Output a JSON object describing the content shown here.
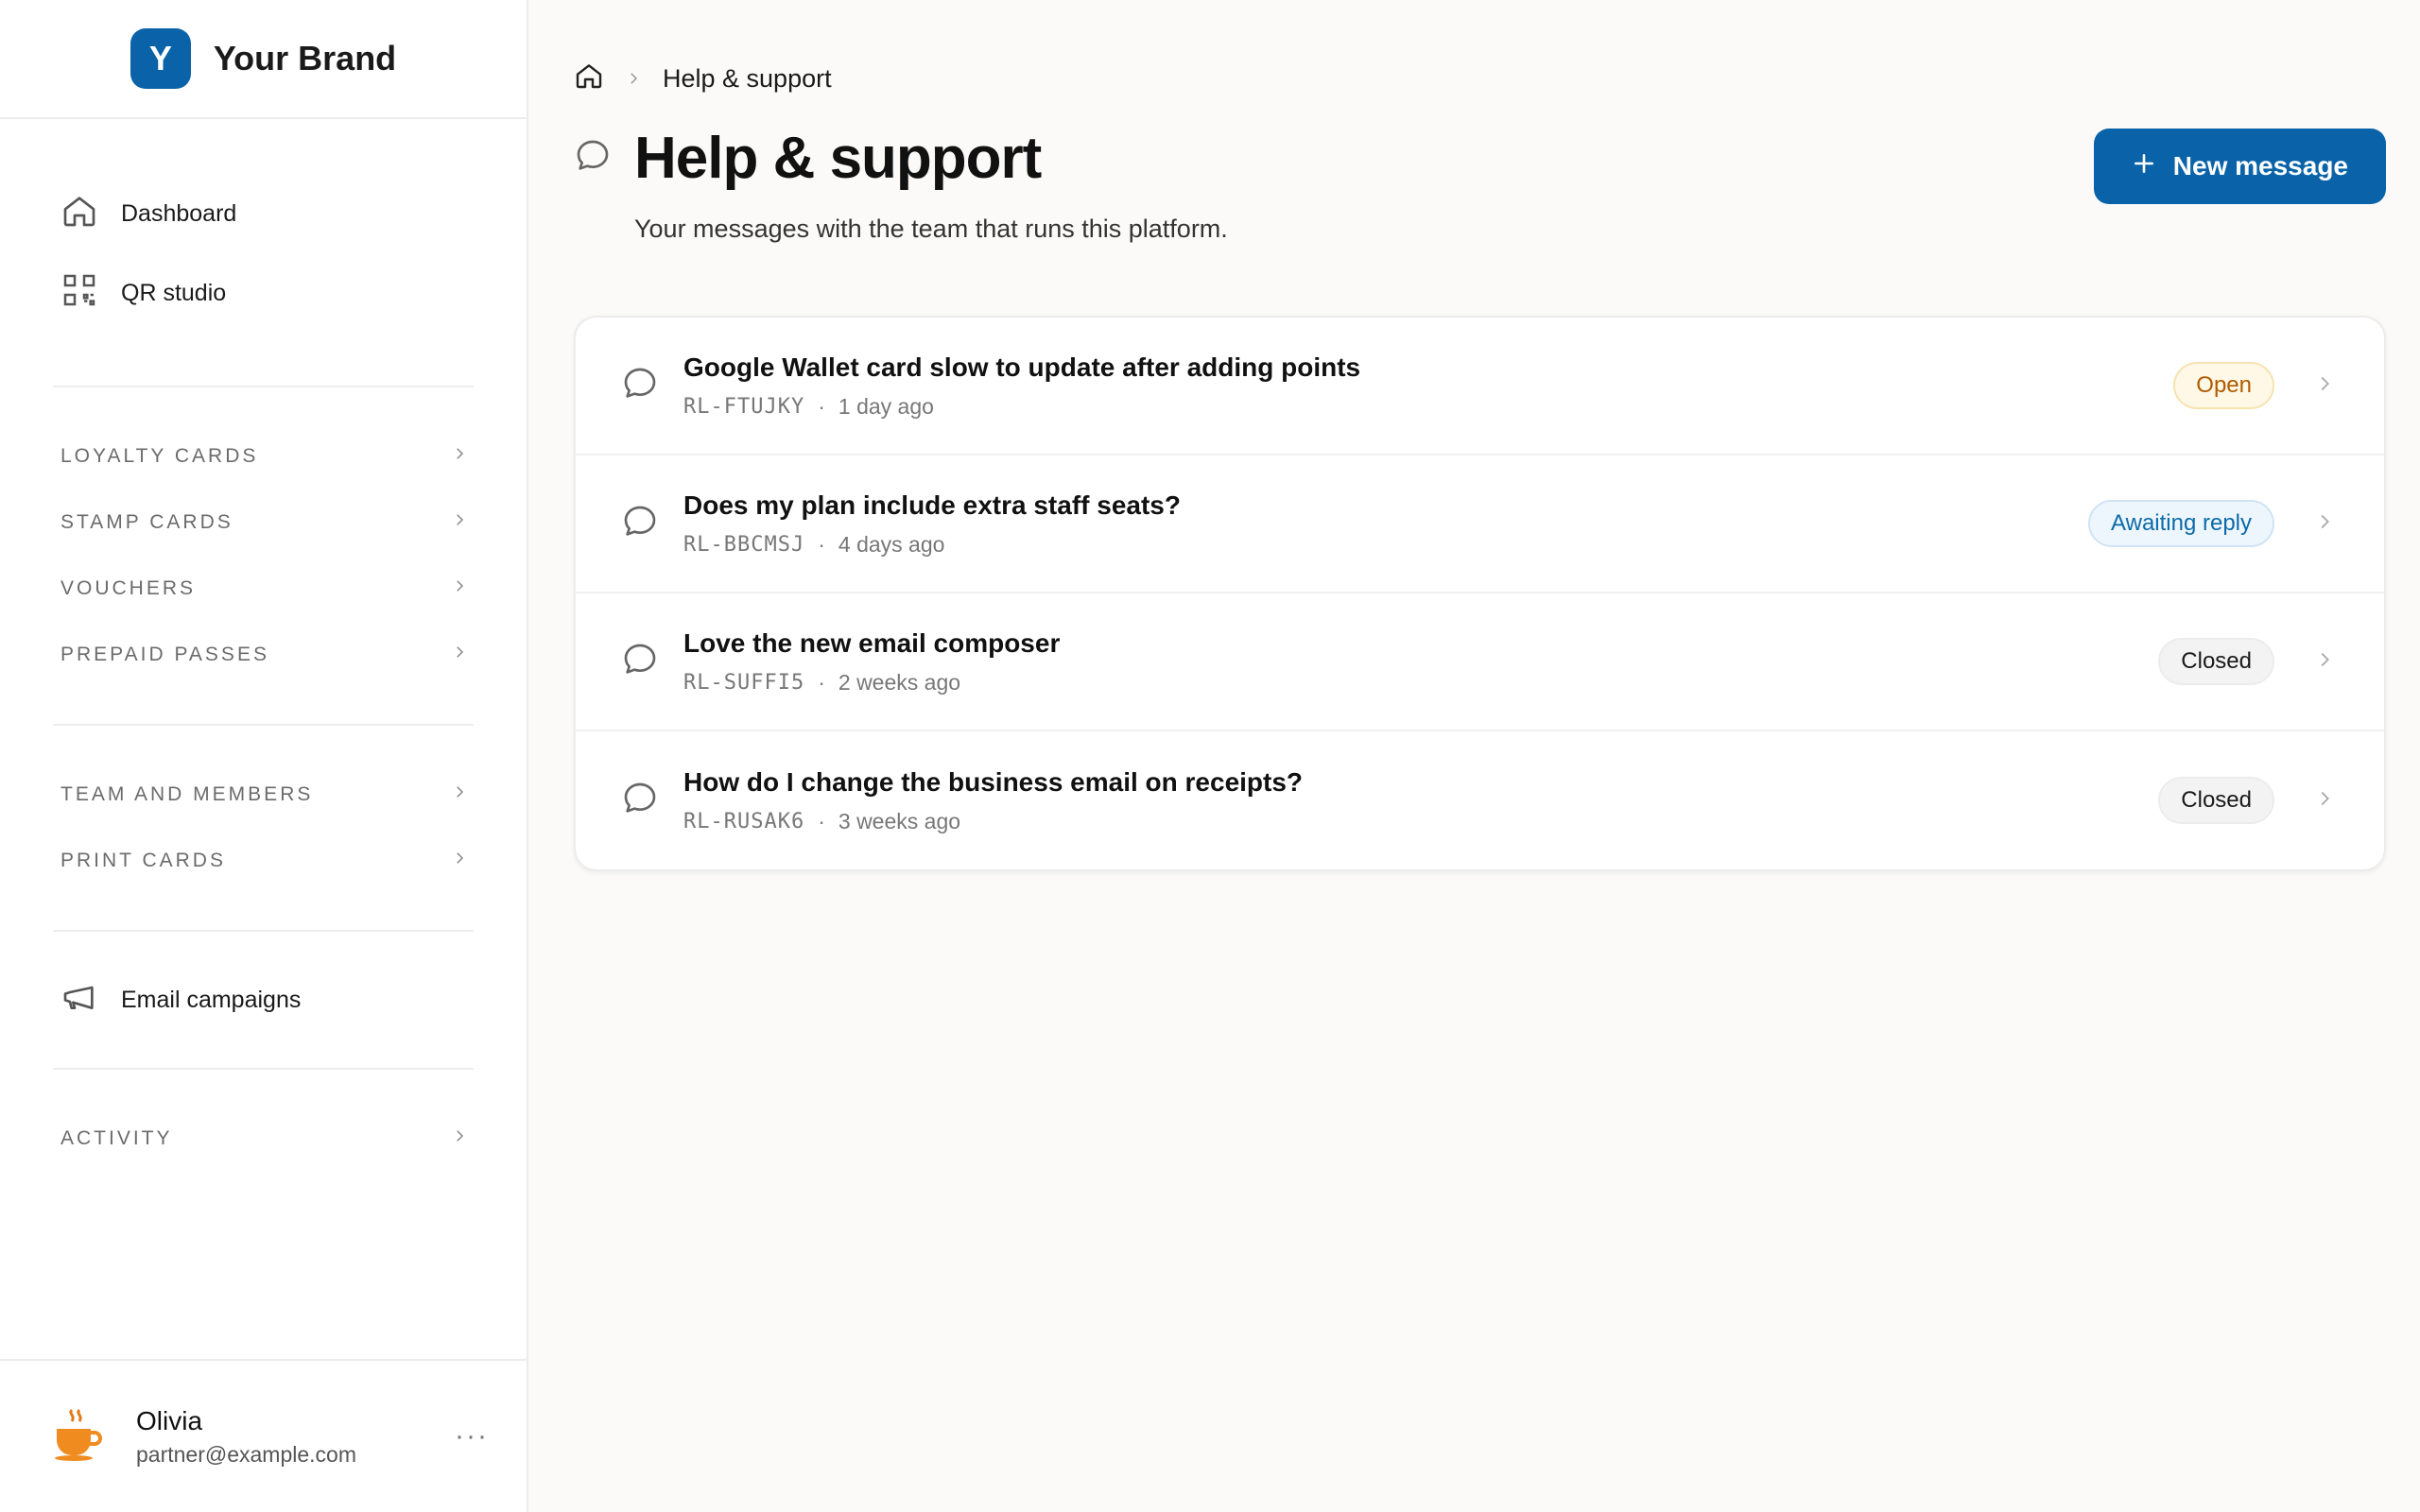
{
  "brand": {
    "initial": "Y",
    "name": "Your Brand",
    "color": "#0a63a8"
  },
  "sidebar": {
    "primary": [
      {
        "label": "Dashboard",
        "icon": "home-icon"
      },
      {
        "label": "QR studio",
        "icon": "qr-code-icon"
      }
    ],
    "group1": [
      {
        "label": "Loyalty cards"
      },
      {
        "label": "Stamp cards"
      },
      {
        "label": "Vouchers"
      },
      {
        "label": "Prepaid passes"
      }
    ],
    "group2": [
      {
        "label": "Team and members"
      },
      {
        "label": "Print cards"
      }
    ],
    "email": {
      "label": "Email campaigns",
      "icon": "megaphone-icon"
    },
    "group3": [
      {
        "label": "Activity"
      }
    ]
  },
  "user": {
    "name": "Olivia",
    "email": "partner@example.com",
    "avatar_icon": "coffee-cup-icon",
    "more": "···"
  },
  "breadcrumb": {
    "current": "Help & support"
  },
  "header": {
    "title": "Help & support",
    "subtitle": "Your messages with the team that runs this platform.",
    "new_button": "New message"
  },
  "tickets": [
    {
      "title": "Google Wallet card slow to update after adding points",
      "code": "RL-FTUJKY",
      "time": "1 day ago",
      "status": "Open",
      "status_kind": "open"
    },
    {
      "title": "Does my plan include extra staff seats?",
      "code": "RL-BBCMSJ",
      "time": "4 days ago",
      "status": "Awaiting reply",
      "status_kind": "awaiting"
    },
    {
      "title": "Love the new email composer",
      "code": "RL-SUFFI5",
      "time": "2 weeks ago",
      "status": "Closed",
      "status_kind": "closed"
    },
    {
      "title": "How do I change the business email on receipts?",
      "code": "RL-RUSAK6",
      "time": "3 weeks ago",
      "status": "Closed",
      "status_kind": "closed"
    }
  ],
  "meta_separator": "·"
}
